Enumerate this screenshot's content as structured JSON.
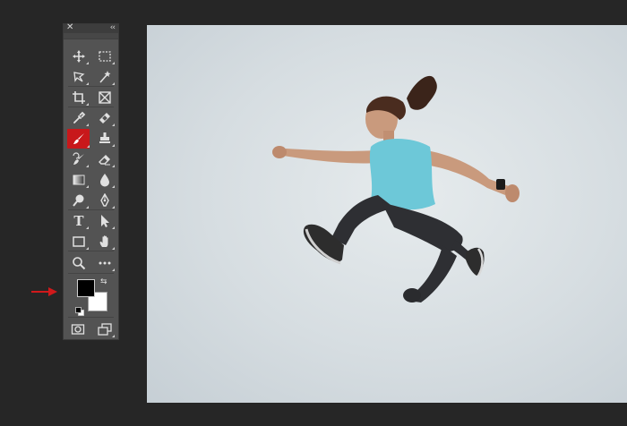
{
  "toolbar": {
    "tools": [
      {
        "name": "move-tool"
      },
      {
        "name": "marquee-tool"
      },
      {
        "name": "lasso-tool"
      },
      {
        "name": "magic-wand-tool"
      },
      {
        "name": "crop-tool"
      },
      {
        "name": "frame-tool"
      },
      {
        "name": "eyedropper-tool"
      },
      {
        "name": "healing-brush-tool"
      },
      {
        "name": "brush-tool",
        "active": true
      },
      {
        "name": "clone-stamp-tool"
      },
      {
        "name": "history-brush-tool"
      },
      {
        "name": "eraser-tool"
      },
      {
        "name": "gradient-tool"
      },
      {
        "name": "blur-tool"
      },
      {
        "name": "dodge-tool"
      },
      {
        "name": "pen-tool"
      },
      {
        "name": "type-tool",
        "glyph": "T"
      },
      {
        "name": "path-selection-tool"
      },
      {
        "name": "rectangle-tool"
      },
      {
        "name": "hand-tool"
      },
      {
        "name": "zoom-tool"
      },
      {
        "name": "edit-toolbar-tool",
        "glyph": "•••"
      }
    ],
    "colors": {
      "foreground": "#000000",
      "background": "#ffffff",
      "active_tool": "#c8181b"
    }
  },
  "annotation": {
    "arrow_color": "#d0191b"
  },
  "canvas": {
    "subject": "jumping-woman-photo"
  }
}
